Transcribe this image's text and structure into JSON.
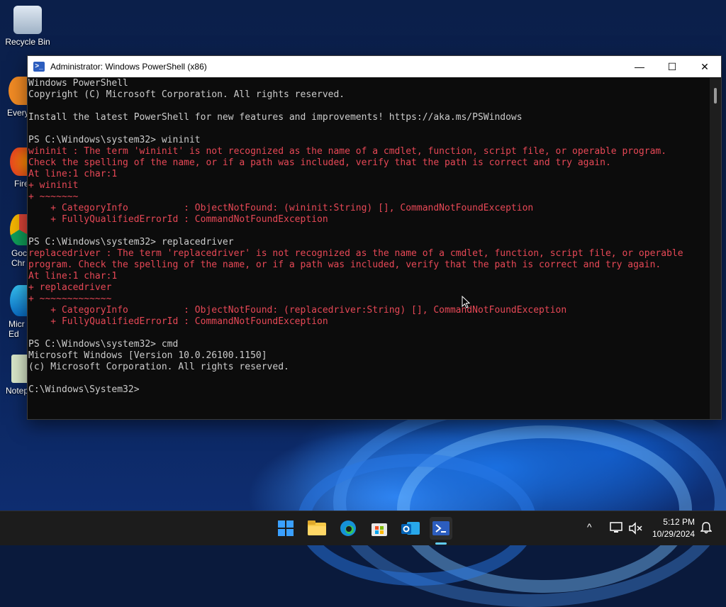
{
  "desktop": {
    "icons": [
      {
        "label": "Recycle Bin"
      },
      {
        "label": "Every"
      },
      {
        "label": "Fire"
      },
      {
        "label": "Goc\nChr"
      },
      {
        "label": "Micr\nEd"
      },
      {
        "label": "Notep"
      }
    ]
  },
  "window": {
    "title": "Administrator: Windows PowerShell (x86)",
    "minimize": "—",
    "maximize": "☐",
    "close": "✕"
  },
  "console": {
    "lines": [
      {
        "text": "Windows PowerShell",
        "color": "w"
      },
      {
        "text": "Copyright (C) Microsoft Corporation. All rights reserved.",
        "color": "w"
      },
      {
        "text": "",
        "color": "w"
      },
      {
        "text": "Install the latest PowerShell for new features and improvements! https://aka.ms/PSWindows",
        "color": "w"
      },
      {
        "text": "",
        "color": "w"
      },
      {
        "text": "PS C:\\Windows\\system32> wininit",
        "color": "w"
      },
      {
        "text": "wininit : The term 'wininit' is not recognized as the name of a cmdlet, function, script file, or operable program.",
        "color": "r"
      },
      {
        "text": "Check the spelling of the name, or if a path was included, verify that the path is correct and try again.",
        "color": "r"
      },
      {
        "text": "At line:1 char:1",
        "color": "r"
      },
      {
        "text": "+ wininit",
        "color": "r"
      },
      {
        "text": "+ ~~~~~~~",
        "color": "r"
      },
      {
        "text": "    + CategoryInfo          : ObjectNotFound: (wininit:String) [], CommandNotFoundException",
        "color": "r"
      },
      {
        "text": "    + FullyQualifiedErrorId : CommandNotFoundException",
        "color": "r"
      },
      {
        "text": "",
        "color": "w"
      },
      {
        "text": "PS C:\\Windows\\system32> replacedriver",
        "color": "w"
      },
      {
        "text": "replacedriver : The term 'replacedriver' is not recognized as the name of a cmdlet, function, script file, or operable",
        "color": "r"
      },
      {
        "text": "program. Check the spelling of the name, or if a path was included, verify that the path is correct and try again.",
        "color": "r"
      },
      {
        "text": "At line:1 char:1",
        "color": "r"
      },
      {
        "text": "+ replacedriver",
        "color": "r"
      },
      {
        "text": "+ ~~~~~~~~~~~~~",
        "color": "r"
      },
      {
        "text": "    + CategoryInfo          : ObjectNotFound: (replacedriver:String) [], CommandNotFoundException",
        "color": "r"
      },
      {
        "text": "    + FullyQualifiedErrorId : CommandNotFoundException",
        "color": "r"
      },
      {
        "text": "",
        "color": "w"
      },
      {
        "text": "PS C:\\Windows\\system32> cmd",
        "color": "w"
      },
      {
        "text": "Microsoft Windows [Version 10.0.26100.1150]",
        "color": "w"
      },
      {
        "text": "(c) Microsoft Corporation. All rights reserved.",
        "color": "w"
      },
      {
        "text": "",
        "color": "w"
      },
      {
        "text": "C:\\Windows\\System32>",
        "color": "w"
      }
    ]
  },
  "taskbar": {
    "apps": [
      "start-icon",
      "file-explorer-icon",
      "edge-icon",
      "store-icon",
      "outlook-icon",
      "powershell-icon"
    ],
    "tray": {
      "chevron": "^",
      "time": "5:12 PM",
      "date": "10/29/2024"
    }
  },
  "colors": {
    "console_bg": "#0c0c0c",
    "console_text": "#cccccc",
    "error_text": "#e74856",
    "taskbar_bg": "#1c1c1c",
    "accent": "#60cdff"
  }
}
